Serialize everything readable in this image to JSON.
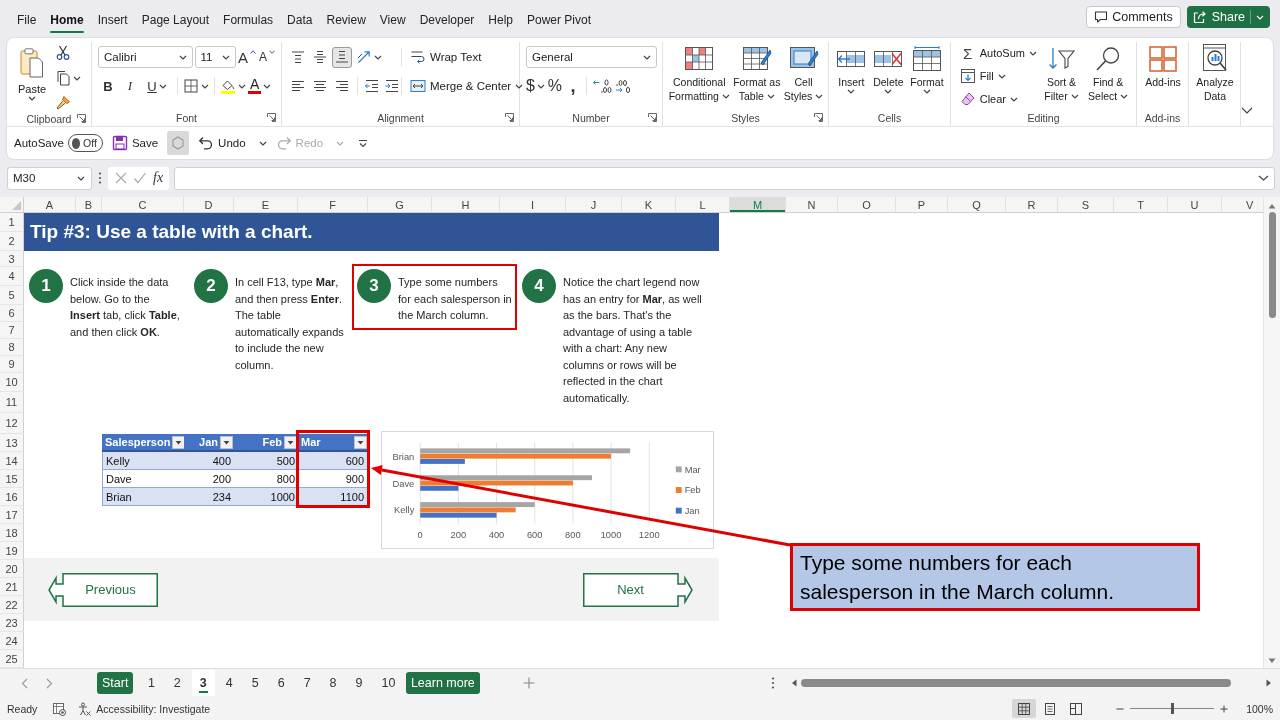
{
  "ribbon_tabs": [
    {
      "label": "File",
      "selected": false
    },
    {
      "label": "Home",
      "selected": true
    },
    {
      "label": "Insert",
      "selected": false
    },
    {
      "label": "Page Layout",
      "selected": false
    },
    {
      "label": "Formulas",
      "selected": false
    },
    {
      "label": "Data",
      "selected": false
    },
    {
      "label": "Review",
      "selected": false
    },
    {
      "label": "View",
      "selected": false
    },
    {
      "label": "Developer",
      "selected": false
    },
    {
      "label": "Help",
      "selected": false
    },
    {
      "label": "Power Pivot",
      "selected": false
    }
  ],
  "comments_button": "Comments",
  "share_button": "Share",
  "ribbon": {
    "clipboard": {
      "paste": "Paste",
      "label": "Clipboard"
    },
    "font": {
      "font_name": "Calibri",
      "font_size": "11",
      "grow_glyph": "A",
      "shrink_glyph": "A",
      "bold": "B",
      "italic": "I",
      "underline": "U",
      "color_glyph": "A",
      "label": "Font"
    },
    "alignment": {
      "vertical": [
        {
          "kind": "top",
          "selected": false
        },
        {
          "kind": "middle",
          "selected": false
        },
        {
          "kind": "bottom",
          "selected": true
        }
      ],
      "wrap_text": "Wrap Text",
      "merge_center": "Merge & Center",
      "label": "Alignment"
    },
    "number": {
      "format": "General",
      "currency": "$",
      "percent": "%",
      "comma": ",",
      "label": "Number"
    },
    "styles": {
      "buttons": [
        {
          "kind": "conditional",
          "lines": [
            "Conditional",
            "Formatting"
          ]
        },
        {
          "kind": "table",
          "lines": [
            "Format as",
            "Table"
          ]
        },
        {
          "kind": "cell",
          "lines": [
            "Cell",
            "Styles"
          ]
        }
      ],
      "label": "Styles"
    },
    "cells": {
      "buttons": [
        {
          "kind": "insert",
          "label": "Insert"
        },
        {
          "kind": "delete",
          "label": "Delete"
        },
        {
          "kind": "format",
          "label": "Format"
        }
      ],
      "label": "Cells"
    },
    "editing": {
      "autosum_glyph": "Σ",
      "small_buttons": [
        {
          "kind": "autosum",
          "label": "AutoSum"
        },
        {
          "kind": "fill",
          "label": "Fill"
        },
        {
          "kind": "clear",
          "label": "Clear"
        }
      ],
      "big_buttons": [
        {
          "kind": "sort",
          "lines": [
            "Sort &",
            "Filter"
          ]
        },
        {
          "kind": "find",
          "lines": [
            "Find &",
            "Select"
          ]
        }
      ],
      "label": "Editing"
    },
    "addins": {
      "button": "Add-ins",
      "label": "Add-ins"
    },
    "analyze": {
      "lines": [
        "Analyze",
        "Data"
      ]
    }
  },
  "quick_access": {
    "autosave_label": "AutoSave",
    "autosave_on": false,
    "autosave_state": "Off",
    "save": "Save",
    "undo": "Undo",
    "redo": "Redo",
    "redo_disabled": true
  },
  "formula_bar": {
    "name_box": "M30",
    "function_label": "fx"
  },
  "column_headers": [
    {
      "label": "A",
      "selected": false
    },
    {
      "label": "B",
      "selected": false
    },
    {
      "label": "C",
      "selected": false
    },
    {
      "label": "D",
      "selected": false
    },
    {
      "label": "E",
      "selected": false
    },
    {
      "label": "F",
      "selected": false
    },
    {
      "label": "G",
      "selected": false
    },
    {
      "label": "H",
      "selected": false
    },
    {
      "label": "I",
      "selected": false
    },
    {
      "label": "J",
      "selected": false
    },
    {
      "label": "K",
      "selected": false
    },
    {
      "label": "L",
      "selected": false
    },
    {
      "label": "M",
      "selected": true
    },
    {
      "label": "N",
      "selected": false
    },
    {
      "label": "O",
      "selected": false
    },
    {
      "label": "P",
      "selected": false
    },
    {
      "label": "Q",
      "selected": false
    },
    {
      "label": "R",
      "selected": false
    },
    {
      "label": "S",
      "selected": false
    },
    {
      "label": "T",
      "selected": false
    },
    {
      "label": "U",
      "selected": false
    },
    {
      "label": "V",
      "selected": false
    }
  ],
  "row_headers": [
    "1",
    "2",
    "3",
    "4",
    "5",
    "6",
    "7",
    "8",
    "9",
    "10",
    "11",
    "12",
    "13",
    "14",
    "15",
    "16",
    "17",
    "18",
    "19",
    "20",
    "21",
    "22",
    "23",
    "24",
    "25"
  ],
  "title_banner": "Tip #3: Use a table with a chart.",
  "steps": [
    {
      "number": "1",
      "text": "Click inside the data\nbelow. Go to the\n**Insert** tab, click **Table**,\nand then click **OK**.",
      "highlighted": false
    },
    {
      "number": "2",
      "text": "In cell F13, type **Mar**,\nand then press **Enter**.\nThe table\nautomatically expands\nto include the new\ncolumn.",
      "highlighted": false
    },
    {
      "number": "3",
      "text": "Type some numbers\nfor each salesperson in\nthe March column.",
      "highlighted": true
    },
    {
      "number": "4",
      "text": "Notice the chart legend now\nhas an entry for **Mar**, as well\nas the bars. That's the\nadvantage of using a table\nwith a chart: Any new\ncolumns or rows will be\nreflected in the chart\nautomatically.",
      "highlighted": false
    }
  ],
  "table": {
    "columns": [
      {
        "label": "Salesperson",
        "highlighted": false
      },
      {
        "label": "Jan",
        "highlighted": false
      },
      {
        "label": "Feb",
        "highlighted": false
      },
      {
        "label": "Mar",
        "highlighted": true
      }
    ],
    "rows": [
      [
        "Kelly",
        "400",
        "500",
        "600"
      ],
      [
        "Dave",
        "200",
        "800",
        "900"
      ],
      [
        "Brian",
        "234",
        "1000",
        "1100"
      ]
    ]
  },
  "chart": {
    "chart_data": {
      "type": "bar",
      "orientation": "horizontal",
      "categories": [
        "Brian",
        "Dave",
        "Kelly"
      ],
      "series": [
        {
          "name": "Jan",
          "color": "#4472c4",
          "values": [
            234,
            200,
            400
          ]
        },
        {
          "name": "Feb",
          "color": "#ed7d31",
          "values": [
            1000,
            800,
            500
          ]
        },
        {
          "name": "Mar",
          "color": "#a5a5a5",
          "values": [
            1100,
            900,
            600
          ]
        }
      ],
      "xlim": [
        0,
        1200
      ],
      "xticks": [
        {
          "value": 0,
          "label": "0"
        },
        {
          "value": 200,
          "label": "200"
        },
        {
          "value": 400,
          "label": "400"
        },
        {
          "value": 600,
          "label": "600"
        },
        {
          "value": 800,
          "label": "800"
        },
        {
          "value": 1000,
          "label": "1000"
        },
        {
          "value": 1200,
          "label": "1200"
        }
      ],
      "grid": true,
      "legend": true
    }
  },
  "nav_buttons": [
    {
      "kind": "previous",
      "label": "Previous"
    },
    {
      "kind": "next",
      "label": "Next"
    }
  ],
  "callout": "Type some numbers for each salesperson in the March column.",
  "sheet_tabs": [
    {
      "label": "Start",
      "selected": false,
      "color": "#217346"
    },
    {
      "label": "1",
      "selected": false
    },
    {
      "label": "2",
      "selected": false
    },
    {
      "label": "3",
      "selected": true
    },
    {
      "label": "4",
      "selected": false
    },
    {
      "label": "5",
      "selected": false
    },
    {
      "label": "6",
      "selected": false
    },
    {
      "label": "7",
      "selected": false
    },
    {
      "label": "8",
      "selected": false
    },
    {
      "label": "9",
      "selected": false
    },
    {
      "label": "10",
      "selected": false
    },
    {
      "label": "Learn more",
      "selected": false,
      "color": "#217346"
    }
  ],
  "status_bar": {
    "ready": "Ready",
    "accessibility": "Accessibility: Investigate",
    "views": [
      {
        "kind": "normal",
        "selected": true
      },
      {
        "kind": "page_layout",
        "selected": false
      },
      {
        "kind": "page_break",
        "selected": false
      }
    ],
    "zoom": {
      "level": 0.5,
      "label": "100%"
    }
  }
}
